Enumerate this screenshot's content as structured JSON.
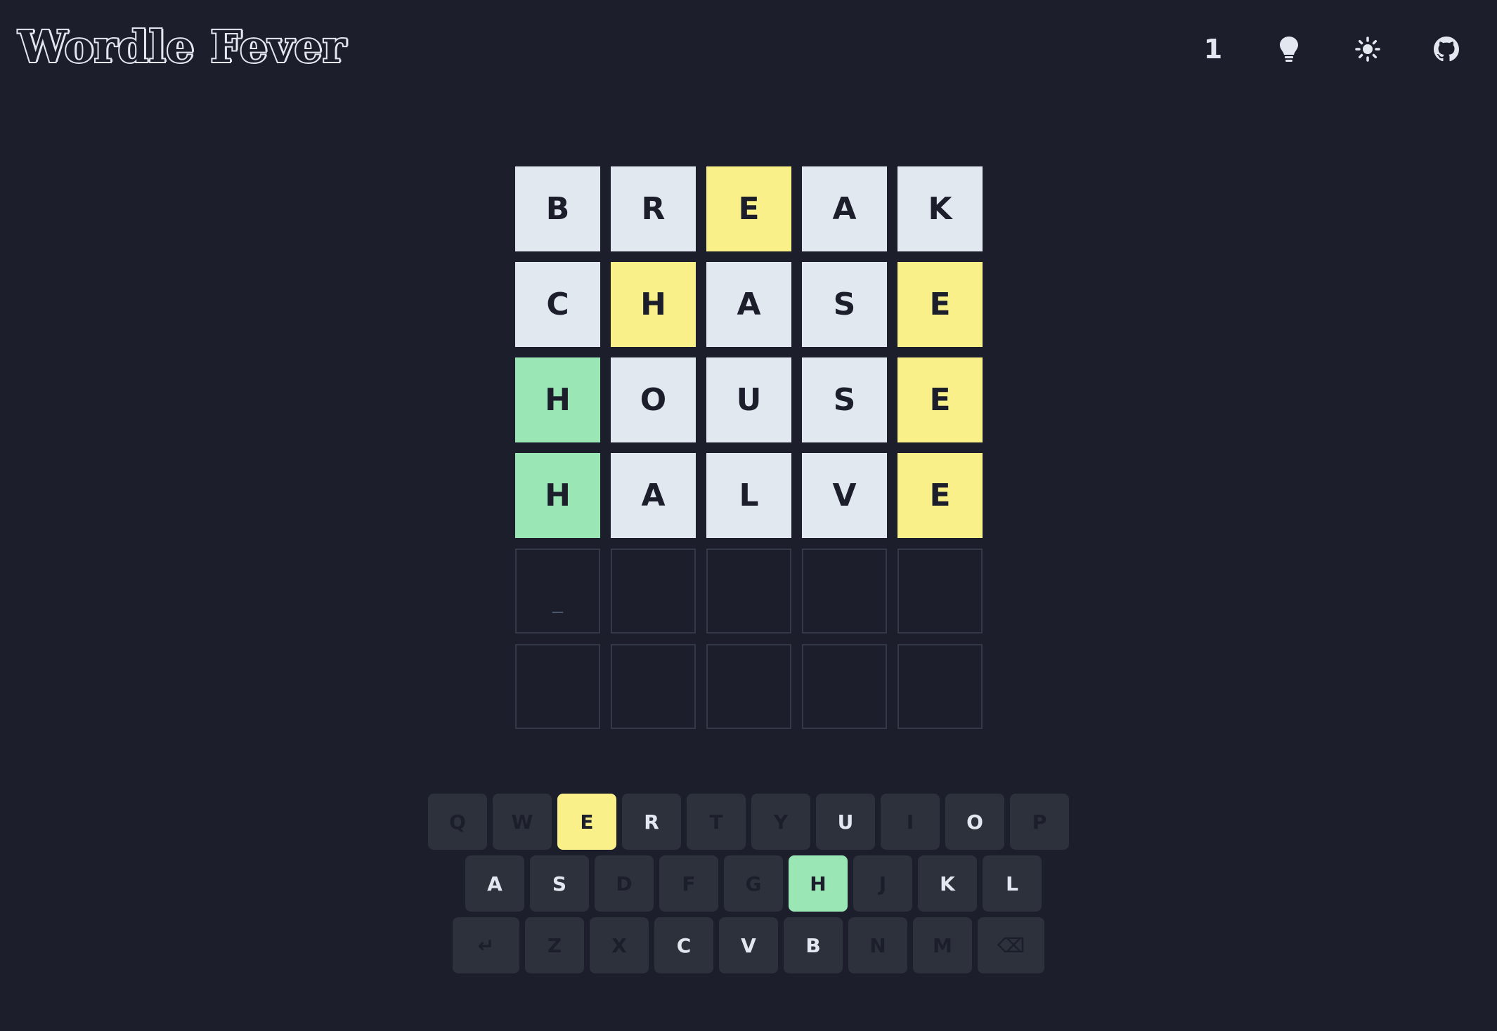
{
  "app": {
    "title": "Wordle Fever"
  },
  "header": {
    "streak_count": "1",
    "icons": [
      "lightbulb-icon",
      "sun-icon",
      "github-icon"
    ]
  },
  "colors": {
    "background": "#1c1f2b",
    "absent": "#e2e8f0",
    "present": "#faf089",
    "correct": "#9ae6b4",
    "key": "#2c313c"
  },
  "board": {
    "rows": [
      [
        {
          "letter": "B",
          "state": "absent"
        },
        {
          "letter": "R",
          "state": "absent"
        },
        {
          "letter": "E",
          "state": "present"
        },
        {
          "letter": "A",
          "state": "absent"
        },
        {
          "letter": "K",
          "state": "absent"
        }
      ],
      [
        {
          "letter": "C",
          "state": "absent"
        },
        {
          "letter": "H",
          "state": "present"
        },
        {
          "letter": "A",
          "state": "absent"
        },
        {
          "letter": "S",
          "state": "absent"
        },
        {
          "letter": "E",
          "state": "present"
        }
      ],
      [
        {
          "letter": "H",
          "state": "correct"
        },
        {
          "letter": "O",
          "state": "absent"
        },
        {
          "letter": "U",
          "state": "absent"
        },
        {
          "letter": "S",
          "state": "absent"
        },
        {
          "letter": "E",
          "state": "present"
        }
      ],
      [
        {
          "letter": "H",
          "state": "correct"
        },
        {
          "letter": "A",
          "state": "absent"
        },
        {
          "letter": "L",
          "state": "absent"
        },
        {
          "letter": "V",
          "state": "absent"
        },
        {
          "letter": "E",
          "state": "present"
        }
      ],
      [
        {
          "letter": "_",
          "state": "empty"
        },
        {
          "letter": "",
          "state": "empty"
        },
        {
          "letter": "",
          "state": "empty"
        },
        {
          "letter": "",
          "state": "empty"
        },
        {
          "letter": "",
          "state": "empty"
        }
      ],
      [
        {
          "letter": "",
          "state": "empty"
        },
        {
          "letter": "",
          "state": "empty"
        },
        {
          "letter": "",
          "state": "empty"
        },
        {
          "letter": "",
          "state": "empty"
        },
        {
          "letter": "",
          "state": "empty"
        }
      ]
    ]
  },
  "keyboard": {
    "rows": [
      [
        {
          "label": "Q",
          "state": "unused"
        },
        {
          "label": "W",
          "state": "unused"
        },
        {
          "label": "E",
          "state": "present"
        },
        {
          "label": "R",
          "state": "absent"
        },
        {
          "label": "T",
          "state": "unused"
        },
        {
          "label": "Y",
          "state": "unused"
        },
        {
          "label": "U",
          "state": "absent"
        },
        {
          "label": "I",
          "state": "unused"
        },
        {
          "label": "O",
          "state": "absent"
        },
        {
          "label": "P",
          "state": "unused"
        }
      ],
      [
        {
          "label": "A",
          "state": "absent"
        },
        {
          "label": "S",
          "state": "absent"
        },
        {
          "label": "D",
          "state": "unused"
        },
        {
          "label": "F",
          "state": "unused"
        },
        {
          "label": "G",
          "state": "unused"
        },
        {
          "label": "H",
          "state": "correct"
        },
        {
          "label": "J",
          "state": "unused"
        },
        {
          "label": "K",
          "state": "absent"
        },
        {
          "label": "L",
          "state": "absent"
        }
      ],
      [
        {
          "label": "↵",
          "state": "unused",
          "name": "enter-key"
        },
        {
          "label": "Z",
          "state": "unused"
        },
        {
          "label": "X",
          "state": "unused"
        },
        {
          "label": "C",
          "state": "absent"
        },
        {
          "label": "V",
          "state": "absent"
        },
        {
          "label": "B",
          "state": "absent"
        },
        {
          "label": "N",
          "state": "unused"
        },
        {
          "label": "M",
          "state": "unused"
        },
        {
          "label": "⌫",
          "state": "unused",
          "name": "backspace-key"
        }
      ]
    ]
  }
}
